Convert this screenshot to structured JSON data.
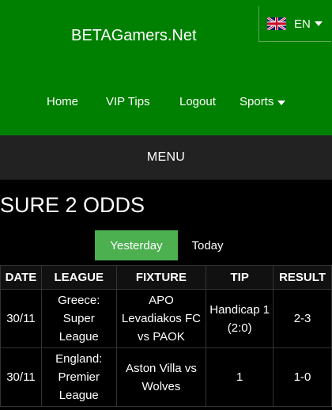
{
  "header": {
    "site_title": "BETAGamers.Net",
    "language": {
      "label": "EN",
      "flag_icon": "uk-flag-icon"
    },
    "bg_color": "#008000"
  },
  "nav": {
    "items": [
      {
        "label": "Home"
      },
      {
        "label": "VIP Tips"
      },
      {
        "label": "Logout"
      },
      {
        "label": "Sports",
        "has_dropdown": true
      }
    ]
  },
  "menu_bar": {
    "label": "MENU"
  },
  "page": {
    "title": "SURE 2 ODDS"
  },
  "tabs": [
    {
      "label": "Yesterday",
      "active": true,
      "color": "#4caf50"
    },
    {
      "label": "Today",
      "active": false
    }
  ],
  "table": {
    "headers": [
      "DATE",
      "LEAGUE",
      "FIXTURE",
      "TIP",
      "RESULT"
    ],
    "rows": [
      {
        "date": "30/11",
        "league": "Greece: Super League",
        "fixture": "APO Levadiakos FC vs PAOK",
        "tip": "Handicap 1 (2:0)",
        "result": "2-3"
      },
      {
        "date": "30/11",
        "league": "England: Premier League",
        "fixture": "Aston Villa vs Wolves",
        "tip": "1",
        "result": "1-0"
      }
    ]
  }
}
